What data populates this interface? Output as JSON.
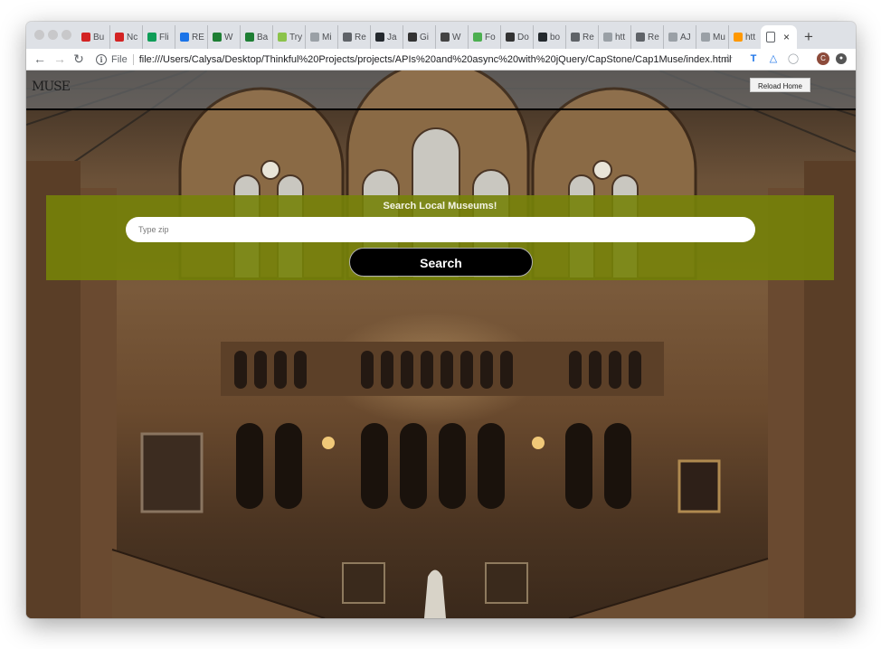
{
  "browser": {
    "tabs": [
      {
        "label": "Bu",
        "icon": "yelp-icon",
        "color": "#d32323"
      },
      {
        "label": "Nc",
        "icon": "yelp-icon",
        "color": "#d32323"
      },
      {
        "label": "Fli",
        "icon": "sheets-icon",
        "color": "#0f9d58"
      },
      {
        "label": "RE",
        "icon": "d-logo-icon",
        "color": "#1a73e8"
      },
      {
        "label": "W",
        "icon": "sheets-icon",
        "color": "#1e7e34"
      },
      {
        "label": "Ba",
        "icon": "sheets-icon",
        "color": "#1e7e34"
      },
      {
        "label": "Try",
        "icon": "green-badge-icon",
        "color": "#8bc34a"
      },
      {
        "label": "Mi",
        "icon": "page-icon",
        "color": "#9aa0a6"
      },
      {
        "label": "Re",
        "icon": "gear-icon",
        "color": "#5f6368"
      },
      {
        "label": "Ja",
        "icon": "github-icon",
        "color": "#24292e"
      },
      {
        "label": "Gi",
        "icon": "thinkful-icon",
        "color": "#333333"
      },
      {
        "label": "W",
        "icon": "grid-icon",
        "color": "#444444"
      },
      {
        "label": "Fo",
        "icon": "leaf-icon",
        "color": "#4caf50"
      },
      {
        "label": "Do",
        "icon": "thinkful-icon",
        "color": "#333333"
      },
      {
        "label": "bo",
        "icon": "github-icon",
        "color": "#24292e"
      },
      {
        "label": "Re",
        "icon": "gear-icon",
        "color": "#5f6368"
      },
      {
        "label": "htt",
        "icon": "page-icon",
        "color": "#9aa0a6"
      },
      {
        "label": "Re",
        "icon": "gear-icon",
        "color": "#5f6368"
      },
      {
        "label": "AJ",
        "icon": "page-icon",
        "color": "#9aa0a6"
      },
      {
        "label": "Mu",
        "icon": "page-icon",
        "color": "#9aa0a6"
      },
      {
        "label": "htt",
        "icon": "triangle-icon",
        "color": "#ff9800"
      }
    ],
    "active_tab": {
      "icon": "page-icon",
      "close": "×"
    },
    "new_tab": "+",
    "scheme": "File",
    "url": "file:///Users/Calysa/Desktop/Thinkful%20Projects/projects/APIs%20and%20async%20with%20jQuery/CapStone/Cap1Muse/index.html",
    "accent": "#768209"
  },
  "page": {
    "logo": "MUSE",
    "reload_label": "Reload Home",
    "search_title": "Search Local Museums!",
    "zip_placeholder": "Type zip",
    "search_label": "Search"
  }
}
